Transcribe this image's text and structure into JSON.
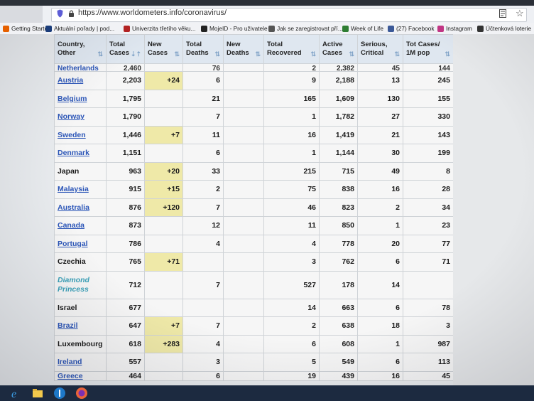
{
  "browser": {
    "url": "https://www.worldometers.info/coronavirus/",
    "bookmarks": [
      {
        "label": "Getting Started",
        "icon": "firefox-icon",
        "color": "#e66000"
      },
      {
        "label": "Aktuální pořady | pod...",
        "icon": "ct-icon",
        "color": "#1a3c7a"
      },
      {
        "label": "Univerzita třetího věku...",
        "icon": "university-icon",
        "color": "#b22222"
      },
      {
        "label": "MojeID - Pro uživatele",
        "icon": "mojeid-icon",
        "color": "#222222"
      },
      {
        "label": "Jak se zaregistrovat pří...",
        "icon": "page-icon",
        "color": "#555555"
      },
      {
        "label": "Week of Life",
        "icon": "globe-icon",
        "color": "#2e7d32"
      },
      {
        "label": "(27) Facebook",
        "icon": "facebook-icon",
        "color": "#3b5998"
      },
      {
        "label": "Instagram",
        "icon": "instagram-icon",
        "color": "#c13584"
      },
      {
        "label": "Účtenková loterie",
        "icon": "lottery-icon",
        "color": "#333333"
      }
    ]
  },
  "table": {
    "headers": [
      {
        "line1": "Country,",
        "line2": "Other"
      },
      {
        "line1": "Total",
        "line2": "Cases"
      },
      {
        "line1": "New",
        "line2": "Cases"
      },
      {
        "line1": "Total",
        "line2": "Deaths"
      },
      {
        "line1": "New",
        "line2": "Deaths"
      },
      {
        "line1": "Total",
        "line2": "Recovered"
      },
      {
        "line1": "Active",
        "line2": "Cases"
      },
      {
        "line1": "Serious,",
        "line2": "Critical"
      },
      {
        "line1": "Tot Cases/",
        "line2": "1M pop"
      }
    ],
    "partial_row": {
      "country": "Netherlands",
      "total_cases": "2,460",
      "new_cases": "",
      "total_deaths": "76",
      "new_deaths": "",
      "recovered": "2",
      "active": "2,382",
      "serious": "45",
      "per_million": "144"
    },
    "rows": [
      {
        "country": "Austria",
        "link": true,
        "total_cases": "2,203",
        "new_cases": "+24",
        "total_deaths": "6",
        "new_deaths": "",
        "recovered": "9",
        "active": "2,188",
        "serious": "13",
        "per_million": "245"
      },
      {
        "country": "Belgium",
        "link": true,
        "total_cases": "1,795",
        "new_cases": "",
        "total_deaths": "21",
        "new_deaths": "",
        "recovered": "165",
        "active": "1,609",
        "serious": "130",
        "per_million": "155"
      },
      {
        "country": "Norway",
        "link": true,
        "total_cases": "1,790",
        "new_cases": "",
        "total_deaths": "7",
        "new_deaths": "",
        "recovered": "1",
        "active": "1,782",
        "serious": "27",
        "per_million": "330"
      },
      {
        "country": "Sweden",
        "link": true,
        "total_cases": "1,446",
        "new_cases": "+7",
        "total_deaths": "11",
        "new_deaths": "",
        "recovered": "16",
        "active": "1,419",
        "serious": "21",
        "per_million": "143"
      },
      {
        "country": "Denmark",
        "link": true,
        "total_cases": "1,151",
        "new_cases": "",
        "total_deaths": "6",
        "new_deaths": "",
        "recovered": "1",
        "active": "1,144",
        "serious": "30",
        "per_million": "199"
      },
      {
        "country": "Japan",
        "link": false,
        "total_cases": "963",
        "new_cases": "+20",
        "total_deaths": "33",
        "new_deaths": "",
        "recovered": "215",
        "active": "715",
        "serious": "49",
        "per_million": "8"
      },
      {
        "country": "Malaysia",
        "link": true,
        "total_cases": "915",
        "new_cases": "+15",
        "total_deaths": "2",
        "new_deaths": "",
        "recovered": "75",
        "active": "838",
        "serious": "16",
        "per_million": "28"
      },
      {
        "country": "Australia",
        "link": true,
        "total_cases": "876",
        "new_cases": "+120",
        "total_deaths": "7",
        "new_deaths": "",
        "recovered": "46",
        "active": "823",
        "serious": "2",
        "per_million": "34"
      },
      {
        "country": "Canada",
        "link": true,
        "total_cases": "873",
        "new_cases": "",
        "total_deaths": "12",
        "new_deaths": "",
        "recovered": "11",
        "active": "850",
        "serious": "1",
        "per_million": "23"
      },
      {
        "country": "Portugal",
        "link": true,
        "total_cases": "786",
        "new_cases": "",
        "total_deaths": "4",
        "new_deaths": "",
        "recovered": "4",
        "active": "778",
        "serious": "20",
        "per_million": "77"
      },
      {
        "country": "Czechia",
        "link": false,
        "total_cases": "765",
        "new_cases": "+71",
        "total_deaths": "",
        "new_deaths": "",
        "recovered": "3",
        "active": "762",
        "serious": "6",
        "per_million": "71"
      },
      {
        "country": "Diamond Princess",
        "link": false,
        "ship": true,
        "total_cases": "712",
        "new_cases": "",
        "total_deaths": "7",
        "new_deaths": "",
        "recovered": "527",
        "active": "178",
        "serious": "14",
        "per_million": ""
      },
      {
        "country": "Israel",
        "link": false,
        "total_cases": "677",
        "new_cases": "",
        "total_deaths": "",
        "new_deaths": "",
        "recovered": "14",
        "active": "663",
        "serious": "6",
        "per_million": "78"
      },
      {
        "country": "Brazil",
        "link": true,
        "total_cases": "647",
        "new_cases": "+7",
        "total_deaths": "7",
        "new_deaths": "",
        "recovered": "2",
        "active": "638",
        "serious": "18",
        "per_million": "3"
      },
      {
        "country": "Luxembourg",
        "link": false,
        "total_cases": "618",
        "new_cases": "+283",
        "total_deaths": "4",
        "new_deaths": "",
        "recovered": "6",
        "active": "608",
        "serious": "1",
        "per_million": "987"
      },
      {
        "country": "Ireland",
        "link": true,
        "total_cases": "557",
        "new_cases": "",
        "total_deaths": "3",
        "new_deaths": "",
        "recovered": "5",
        "active": "549",
        "serious": "6",
        "per_million": "113"
      },
      {
        "country": "Greece",
        "link": true,
        "total_cases": "464",
        "new_cases": "",
        "total_deaths": "6",
        "new_deaths": "",
        "recovered": "19",
        "active": "439",
        "serious": "16",
        "per_million": "45"
      }
    ]
  },
  "taskbar": {
    "icons": [
      "edge-icon",
      "file-explorer-icon",
      "lenovo-icon",
      "firefox-icon"
    ]
  }
}
